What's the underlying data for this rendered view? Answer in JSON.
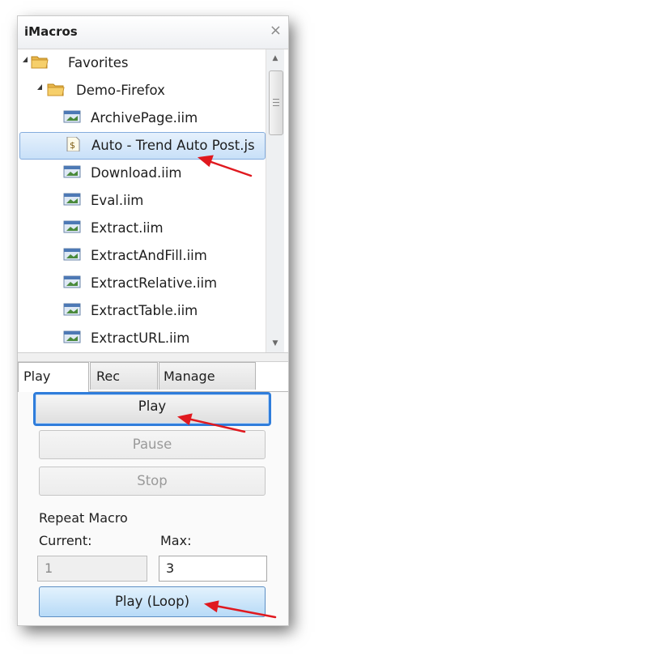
{
  "panel": {
    "title": "iMacros",
    "close_glyph": "×"
  },
  "tree": {
    "folders": [
      {
        "label": "Favorites",
        "icon": "folder-icon"
      },
      {
        "label": "Demo-Firefox",
        "icon": "folder-icon"
      }
    ],
    "items": [
      {
        "label": "ArchivePage.iim",
        "icon": "macro-file-icon"
      },
      {
        "label": "Auto - Trend Auto Post.js",
        "icon": "script-file-icon",
        "selected": true
      },
      {
        "label": "Download.iim",
        "icon": "macro-file-icon"
      },
      {
        "label": "Eval.iim",
        "icon": "macro-file-icon"
      },
      {
        "label": "Extract.iim",
        "icon": "macro-file-icon"
      },
      {
        "label": "ExtractAndFill.iim",
        "icon": "macro-file-icon"
      },
      {
        "label": "ExtractRelative.iim",
        "icon": "macro-file-icon"
      },
      {
        "label": "ExtractTable.iim",
        "icon": "macro-file-icon"
      },
      {
        "label": "ExtractURL.iim",
        "icon": "macro-file-icon"
      }
    ]
  },
  "tabs": [
    {
      "label": "Play"
    },
    {
      "label": "Rec"
    },
    {
      "label": "Manage"
    }
  ],
  "play": {
    "play_label": "Play",
    "pause_label": "Pause",
    "stop_label": "Stop",
    "repeat_label": "Repeat Macro",
    "current_label": "Current:",
    "max_label": "Max:",
    "current_value": "1",
    "max_value": "3",
    "loop_label": "Play (Loop)"
  },
  "colors": {
    "annotation_arrow": "#e0191f",
    "focus_border": "#2f7ddb",
    "selection": "#c8e0f8"
  }
}
